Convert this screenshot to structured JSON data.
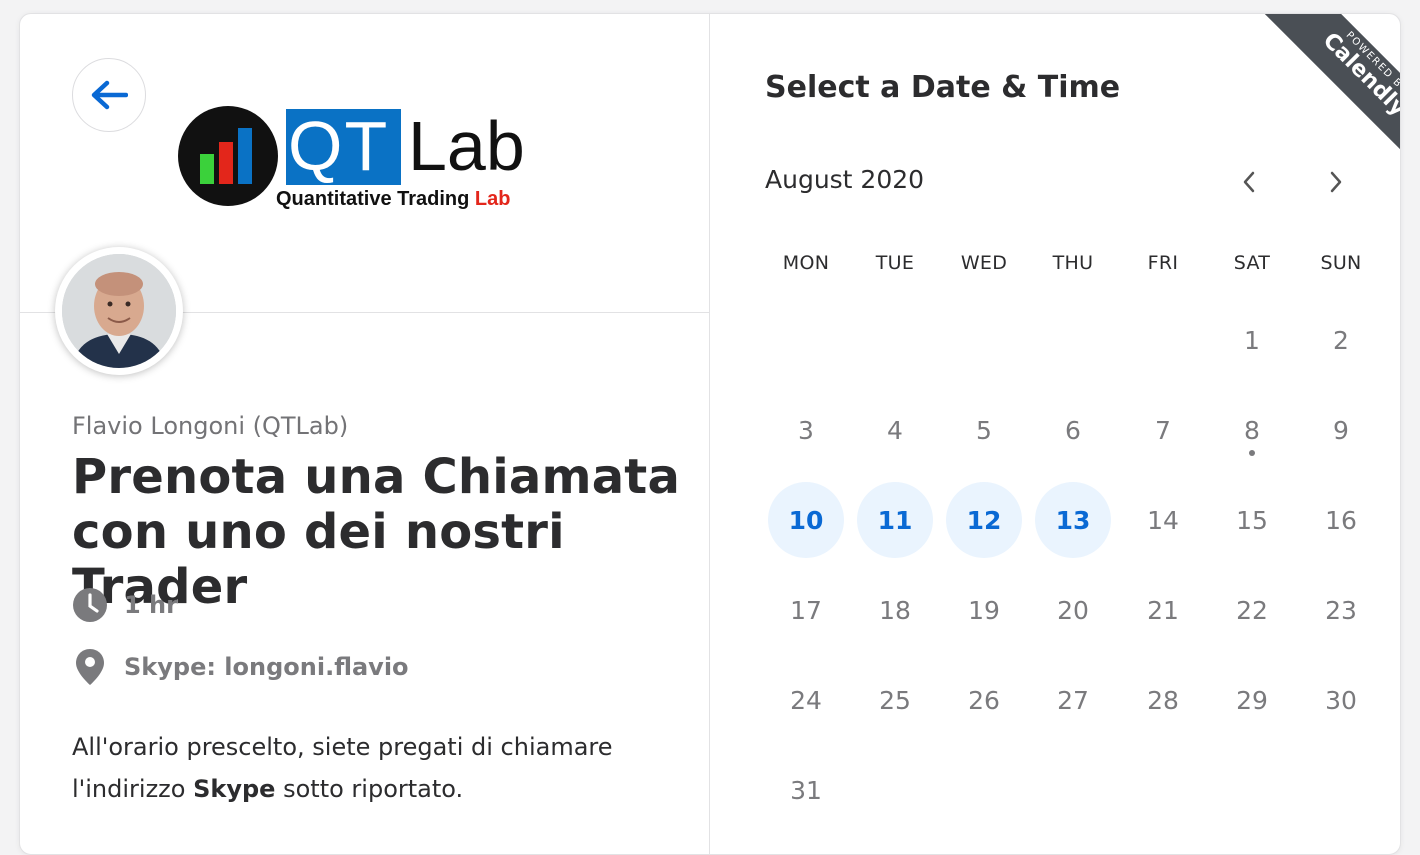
{
  "host": {
    "name": "Flavio Longoni (QTLab)"
  },
  "logo": {
    "brand_qt": "QT",
    "brand_lab": "Lab",
    "tagline_main": "Quantitative Trading",
    "tagline_accent": "Lab"
  },
  "event": {
    "title_line1": "Prenota una Chiamata",
    "title_line2": "con uno dei nostri Trader",
    "duration": "1 hr",
    "location": "Skype: longoni.flavio",
    "description_part1": "All'orario prescelto, siete pregati di chiamare l'indirizzo",
    "description_bold": "Skype",
    "description_part2": "sotto riportato."
  },
  "calendar": {
    "heading": "Select a Date & Time",
    "month": "August 2020",
    "weekdays": [
      "MON",
      "TUE",
      "WED",
      "THU",
      "FRI",
      "SAT",
      "SUN"
    ],
    "days": [
      {
        "n": "1"
      },
      {
        "n": "2"
      },
      {
        "n": "3"
      },
      {
        "n": "4"
      },
      {
        "n": "5"
      },
      {
        "n": "6"
      },
      {
        "n": "7"
      },
      {
        "n": "8"
      },
      {
        "n": "9"
      },
      {
        "n": "10",
        "available": true
      },
      {
        "n": "11",
        "available": true
      },
      {
        "n": "12",
        "available": true
      },
      {
        "n": "13",
        "available": true
      },
      {
        "n": "14"
      },
      {
        "n": "15"
      },
      {
        "n": "16"
      },
      {
        "n": "17"
      },
      {
        "n": "18"
      },
      {
        "n": "19"
      },
      {
        "n": "20"
      },
      {
        "n": "21"
      },
      {
        "n": "22"
      },
      {
        "n": "23"
      },
      {
        "n": "24"
      },
      {
        "n": "25"
      },
      {
        "n": "26"
      },
      {
        "n": "27"
      },
      {
        "n": "28"
      },
      {
        "n": "29"
      },
      {
        "n": "30"
      },
      {
        "n": "31"
      }
    ],
    "today": "8"
  },
  "ribbon": {
    "small": "POWERED BY",
    "brand": "Calendly"
  },
  "icons": {
    "back": "arrow-left-icon",
    "prev": "chevron-left-icon",
    "next": "chevron-right-icon",
    "duration": "clock-icon",
    "location": "map-pin-icon"
  },
  "colors": {
    "accent": "#0a69d4",
    "available_bg": "#eaf4fe",
    "ribbon": "#4a4f55",
    "logo_blue": "#0a72c5",
    "logo_red": "#e3261b"
  }
}
